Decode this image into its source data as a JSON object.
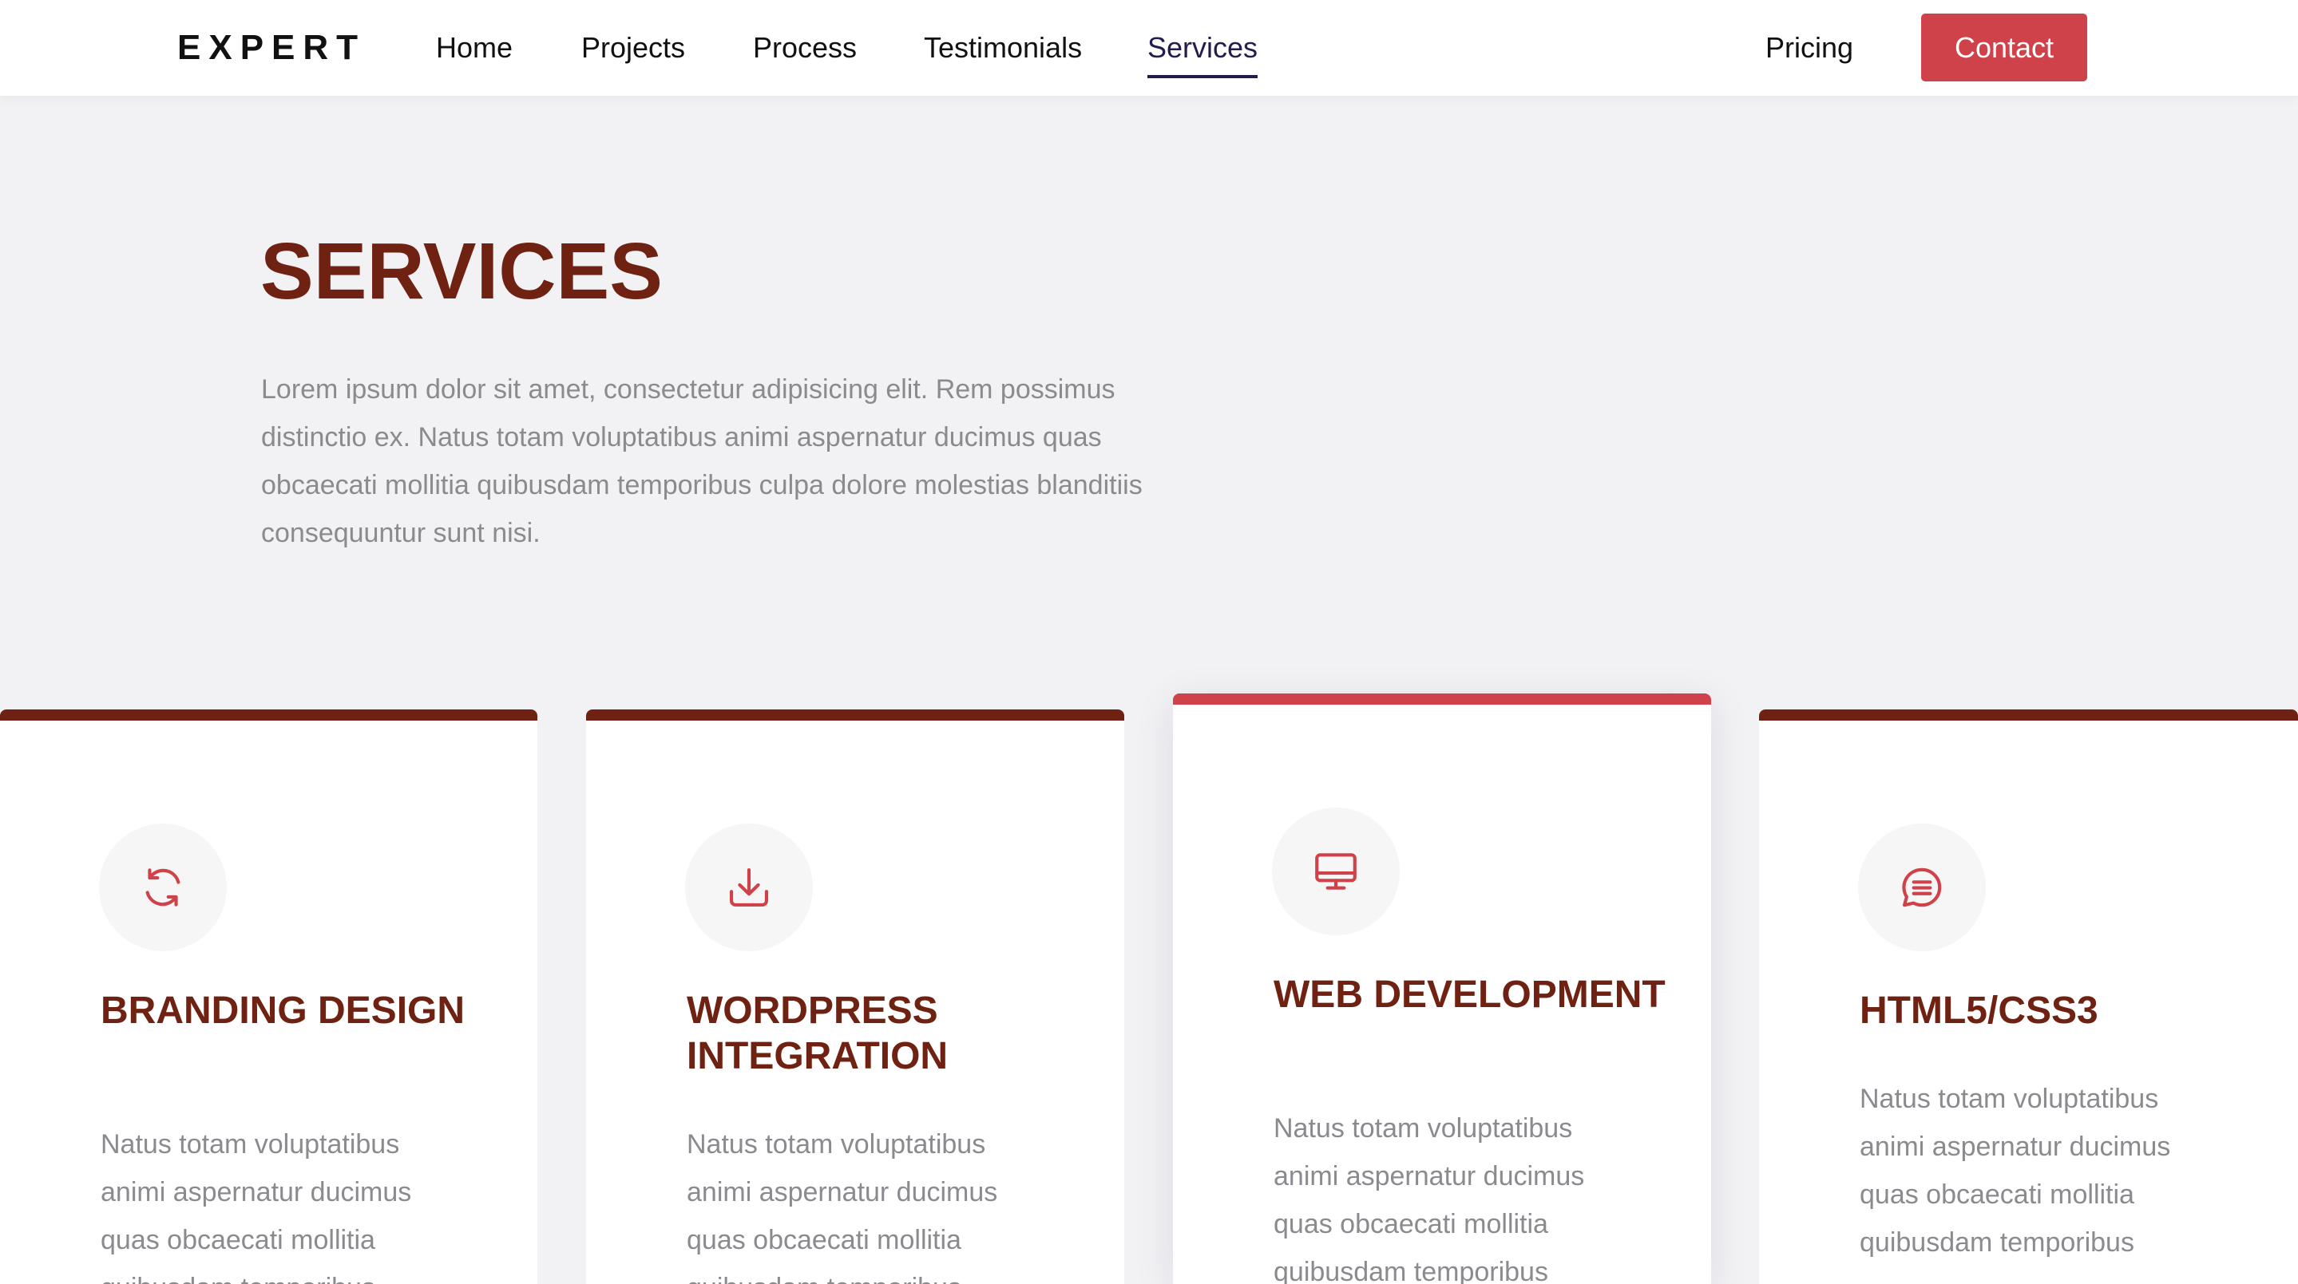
{
  "brand": {
    "logo": "EXPERT"
  },
  "nav": {
    "links": [
      {
        "label": "Home"
      },
      {
        "label": "Projects"
      },
      {
        "label": "Process"
      },
      {
        "label": "Testimonials"
      },
      {
        "label": "Services",
        "active": true
      },
      {
        "label": "Pricing"
      }
    ],
    "contact_label": "Contact"
  },
  "hero": {
    "title": "SERVICES",
    "text": "Lorem ipsum dolor sit amet, consectetur adipisicing elit. Rem possimus distinctio ex. Natus totam voluptatibus animi aspernatur ducimus quas obcaecati mollitia quibusdam temporibus culpa dolore molestias blanditiis consequuntur sunt nisi."
  },
  "cards": [
    {
      "icon": "refresh-icon",
      "title": "BRANDING DESIGN",
      "text": "Natus totam voluptatibus animi aspernatur ducimus quas obcaecati mollitia quibusdam temporibus"
    },
    {
      "icon": "download-icon",
      "title": "WORDPRESS INTEGRATION",
      "text": "Natus totam voluptatibus animi aspernatur ducimus quas obcaecati mollitia quibusdam temporibus"
    },
    {
      "icon": "monitor-icon",
      "title": "WEB DEVELOPMENT",
      "text": "Natus totam voluptatibus animi aspernatur ducimus quas obcaecati mollitia quibusdam temporibus",
      "featured": true
    },
    {
      "icon": "chat-icon",
      "title": "HTML5/CSS3",
      "text": "Natus totam voluptatibus animi aspernatur ducimus quas obcaecati mollitia quibusdam temporibus"
    }
  ],
  "colors": {
    "primary_dark_red": "#6f2212",
    "accent_red": "#d0424a",
    "active_nav": "#221d4e",
    "page_background": "#f2f2f5",
    "body_text_gray": "#8a8a8f"
  }
}
